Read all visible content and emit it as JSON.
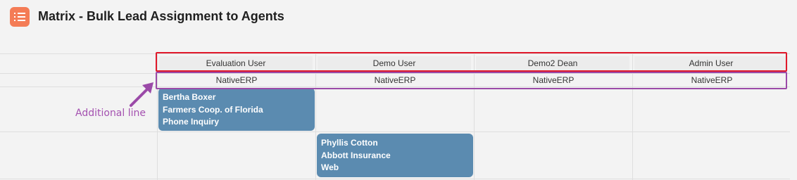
{
  "header": {
    "title": "Matrix - Bulk Lead Assignment to Agents",
    "icon": "list-icon",
    "icon_color": "#f47c56"
  },
  "columns": [
    {
      "user": "Evaluation User",
      "company": "NativeERP"
    },
    {
      "user": "Demo User",
      "company": "NativeERP"
    },
    {
      "user": "Demo2 Dean",
      "company": "NativeERP"
    },
    {
      "user": "Admin User",
      "company": "NativeERP"
    }
  ],
  "rows": [
    {
      "column_index": 0,
      "card": {
        "name": "Bertha Boxer",
        "company": "Farmers Coop. of Florida",
        "source": "Phone Inquiry"
      }
    },
    {
      "column_index": 1,
      "card": {
        "name": "Phyllis Cotton",
        "company": "Abbott Insurance",
        "source": "Web"
      }
    }
  ],
  "annotation": {
    "label": "Additional line",
    "arrow_icon": "arrow-up-right-icon",
    "label_color": "#a451b0",
    "header_highlight_color": "#e0182a",
    "subheader_highlight_color": "#9b4aa8"
  },
  "colors": {
    "card_background": "#5b8bb0",
    "page_background": "#f3f3f3",
    "grid_line": "#dedede"
  }
}
